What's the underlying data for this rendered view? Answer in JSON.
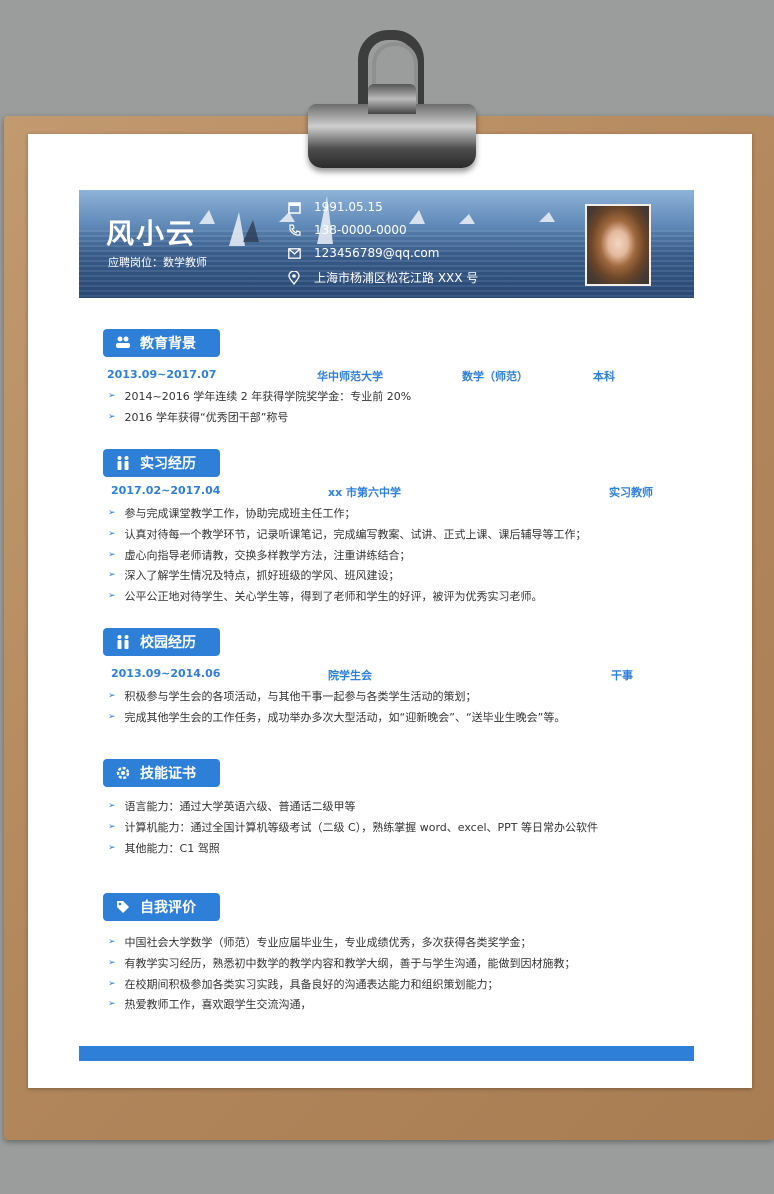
{
  "header": {
    "name": "风小云",
    "post": "应聘岗位：数学教师",
    "birth": "1991.05.15",
    "phone": "138-0000-0000",
    "email": "123456789@qq.com",
    "address": "上海市杨浦区松花江路 XXX 号"
  },
  "education": {
    "title": "教育背景",
    "period": "2013.09~2017.07",
    "school": "华中师范大学",
    "major": "数学（师范）",
    "degree": "本科",
    "items": [
      "2014~2016 学年连续 2 年获得学院奖学金：专业前 20%",
      "2016 学年获得“优秀团干部”称号"
    ]
  },
  "internship": {
    "title": "实习经历",
    "period": "2017.02~2017.04",
    "org": "xx 市第六中学",
    "role": "实习教师",
    "items": [
      "参与完成课堂教学工作，协助完成班主任工作；",
      "认真对待每一个教学环节，记录听课笔记，完成编写教案、试讲、正式上课、课后辅导等工作；",
      "虚心向指导老师请教，交换多样教学方法，注重讲练结合；",
      "深入了解学生情况及特点，抓好班级的学风、班风建设；",
      "公平公正地对待学生、关心学生等，得到了老师和学生的好评，被评为优秀实习老师。"
    ]
  },
  "campus": {
    "title": "校园经历",
    "period": "2013.09~2014.06",
    "org": "院学生会",
    "role": "干事",
    "items": [
      "积极参与学生会的各项活动，与其他干事一起参与各类学生活动的策划；",
      "完成其他学生会的工作任务，成功举办多次大型活动，如“迎新晚会”、“送毕业生晚会”等。"
    ]
  },
  "skills": {
    "title": "技能证书",
    "items": [
      "语言能力：通过大学英语六级、普通话二级甲等",
      "计算机能力：通过全国计算机等级考试（二级 C），熟练掌握 word、excel、PPT 等日常办公软件",
      "其他能力：C1 驾照"
    ]
  },
  "self": {
    "title": "自我评价",
    "items": [
      "中国社会大学数学（师范）专业应届毕业生，专业成绩优秀，多次获得各类奖学金；",
      "有教学实习经历，熟悉初中数学的教学内容和教学大纲，善于与学生沟通，能做到因材施教；",
      "在校期间积极参加各类实习实践，具备良好的沟通表达能力和组织策划能力；",
      "热爱教师工作，喜欢跟学生交流沟通，"
    ]
  },
  "colors": {
    "accent": "#2e7fd8",
    "board": "#b98d62"
  }
}
